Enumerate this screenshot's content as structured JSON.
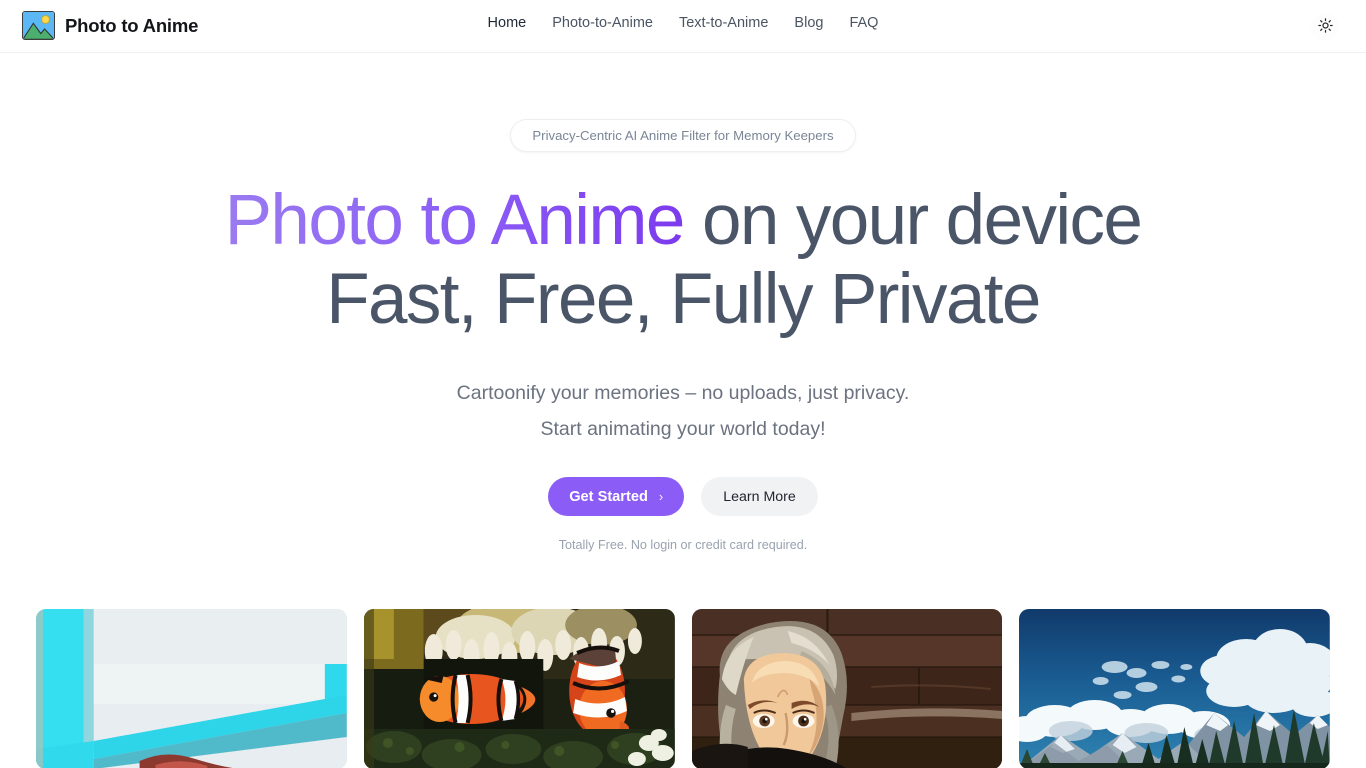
{
  "header": {
    "brand_name": "Photo to Anime",
    "logo_icon": "picture-image-icon",
    "nav": [
      {
        "label": "Home",
        "active": true
      },
      {
        "label": "Photo-to-Anime",
        "active": false
      },
      {
        "label": "Text-to-Anime",
        "active": false
      },
      {
        "label": "Blog",
        "active": false
      },
      {
        "label": "FAQ",
        "active": false
      }
    ],
    "theme_toggle_icon": "sun-icon"
  },
  "hero": {
    "badge": "Privacy-Centric AI Anime Filter for Memory Keepers",
    "title_gradient": "Photo to Anime",
    "title_rest": " on your device",
    "title_line2": "Fast, Free, Fully Private",
    "subtitle_line1": "Cartoonify your memories – no uploads, just privacy.",
    "subtitle_line2": "Start animating your world today!",
    "primary_button": "Get Started",
    "primary_button_icon": "chevron-right-icon",
    "secondary_button": "Learn More",
    "note": "Totally Free. No login or credit card required."
  },
  "gallery": {
    "items": [
      {
        "name": "cyan-framed-photo",
        "alt": "Anime-styled photo with bright cyan border frame"
      },
      {
        "name": "clownfish-reef",
        "alt": "Two clownfish among sea anemone, anime filtered"
      },
      {
        "name": "portrait-wood-wall",
        "alt": "Portrait of person with silver hair against dark wood wall"
      },
      {
        "name": "mountain-clouds",
        "alt": "Mountain range with clouds and pine forest, anime filtered"
      }
    ]
  },
  "colors": {
    "accent": "#8b5cf6",
    "accent_light": "#9a7bf0",
    "text_dark": "#4a5568",
    "text_muted": "#6b7280",
    "secondary_bg": "#f1f2f4"
  }
}
